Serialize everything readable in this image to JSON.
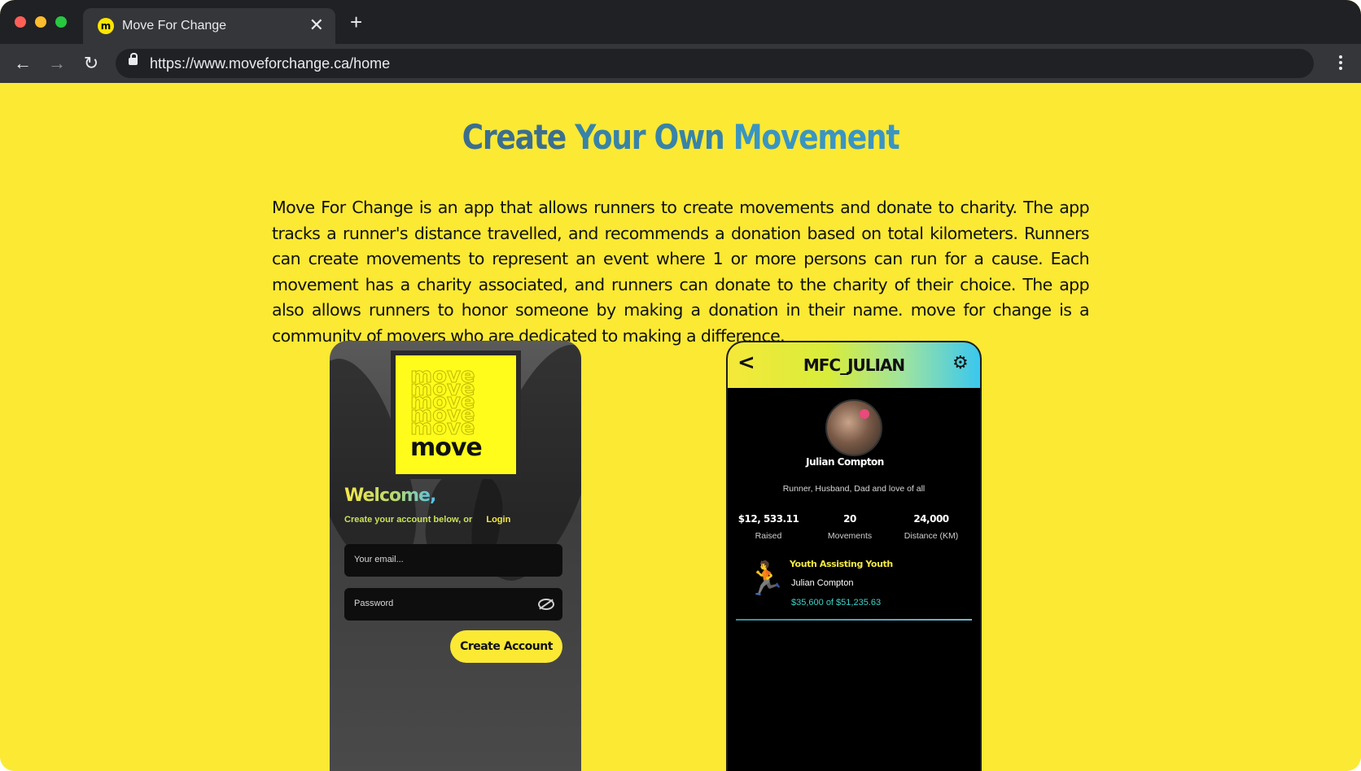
{
  "browser": {
    "tab_title": "Move For Change",
    "favicon_letter": "m",
    "close_symbol": "✕",
    "new_tab_symbol": "+",
    "url": "https://www.moveforchange.ca/home",
    "back_symbol": "←",
    "forward_symbol": "→",
    "reload_symbol": "↻"
  },
  "page": {
    "headline_words": [
      "Create",
      "Your Own",
      "Movement"
    ],
    "description": "Move For Change is an app that allows runners to create movements and donate to charity. The app tracks a runner's distance travelled, and recommends a donation based on total kilometers. Runners can create movements to represent an event where 1 or more persons can run for a cause. Each movement has a charity associated, and runners can donate to the charity of their choice. The app also allows runners to honor someone by making a donation in their name. move for change is a community of movers who are dedicated to making a difference.",
    "colors": {
      "background": "#fbe934",
      "headline_accent": "#3a95c2"
    }
  },
  "signup_phone": {
    "logo_echo": [
      "move",
      "move",
      "move",
      "move",
      "move"
    ],
    "logo_word": "move",
    "welcome": "Welcome,",
    "subtitle": "Create your account below, or",
    "login_link": "Login",
    "email_placeholder": "Your email...",
    "password_placeholder": "Password",
    "create_button": "Create Account"
  },
  "profile_phone": {
    "back_symbol": "<",
    "username": "MFC_JULIAN",
    "gear_symbol": "⚙",
    "name": "Julian Compton",
    "bio": "Runner, Husband, Dad and love of all",
    "stats": [
      {
        "value": "$12, 533.11",
        "label": "Raised"
      },
      {
        "value": "20",
        "label": "Movements"
      },
      {
        "value": "24,000",
        "label": "Distance (KM)"
      }
    ],
    "movement": {
      "icon": "running-person-icon",
      "icon_glyph": "🏃",
      "title": "Youth Assisting Youth",
      "owner": "Julian Compton",
      "amount": "$35,600 of $51,235.63"
    }
  }
}
